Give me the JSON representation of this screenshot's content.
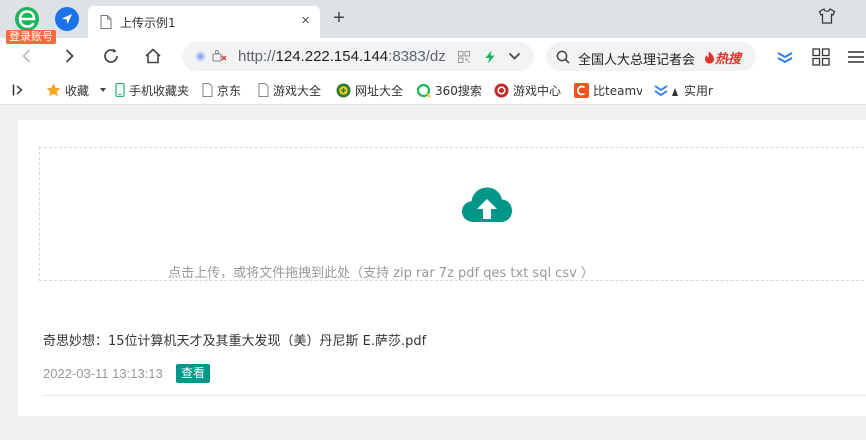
{
  "browser": {
    "login_badge": "登录账号",
    "tab": {
      "title": "上传示例1",
      "close": "×"
    },
    "new_tab": "+",
    "address": {
      "scheme": "http://",
      "host": "124.222.154.144",
      "rest": ":8383/dz"
    },
    "search": {
      "query": "全国人大总理记者会",
      "hot_label": "热搜"
    }
  },
  "bookmarks": [
    {
      "label": "收藏",
      "icon": "star-icon"
    },
    {
      "label": "手机收藏夹",
      "icon": "phone-icon"
    },
    {
      "label": "京东",
      "icon": "page-icon"
    },
    {
      "label": "游戏大全",
      "icon": "page-icon"
    },
    {
      "label": "网址大全",
      "icon": "site-nav-icon"
    },
    {
      "label": "360搜索",
      "icon": "search360-icon"
    },
    {
      "label": "游戏中心",
      "icon": "game-center-icon"
    },
    {
      "label": "比teamv",
      "icon": "c-logo-icon"
    },
    {
      "label": "实用r",
      "icon": "useful-icon"
    }
  ],
  "upload": {
    "hint": "点击上传，或将文件拖拽到此处（支持 zip rar 7z pdf qes txt sql csv ）",
    "file": {
      "name": "奇思妙想：15位计算机天才及其重大发现（美）丹尼斯 E.萨莎.pdf",
      "date": "2022-03-11 13:13:13",
      "view_label": "查看"
    }
  },
  "colors": {
    "accent": "#009688",
    "badge": "#f36c3b",
    "browser_blue": "#1a73e8"
  }
}
